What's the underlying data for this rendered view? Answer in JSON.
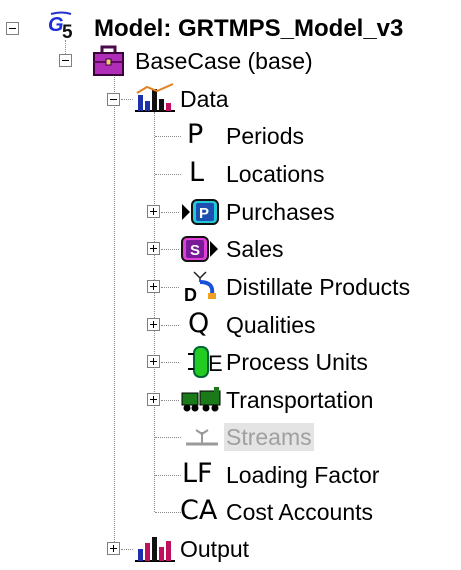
{
  "tree": {
    "root": {
      "label": "Model: GRTMPS_Model_v3",
      "icon": "gs-model-icon"
    },
    "basecase": {
      "label": "BaseCase (base)",
      "icon": "briefcase-icon"
    },
    "data": {
      "label": "Data",
      "icon": "chart-icon",
      "children": [
        {
          "label": "Periods",
          "icon_text": "P"
        },
        {
          "label": "Locations",
          "icon_text": "L"
        },
        {
          "label": "Purchases",
          "icon": "purchases-icon",
          "icon_text": "P"
        },
        {
          "label": "Sales",
          "icon": "sales-icon",
          "icon_text": "S"
        },
        {
          "label": "Distillate Products",
          "icon": "distillate-icon",
          "icon_text": "D"
        },
        {
          "label": "Qualities",
          "icon_text": "Q"
        },
        {
          "label": "Process Units",
          "icon": "process-unit-icon",
          "icon_text": "E"
        },
        {
          "label": "Transportation",
          "icon": "train-icon"
        },
        {
          "label": "Streams",
          "icon": "streams-icon",
          "state": "disabled"
        },
        {
          "label": "Loading Factor",
          "icon_text": "LF"
        },
        {
          "label": "Cost Accounts",
          "icon_text": "CA"
        }
      ]
    },
    "output": {
      "label": "Output",
      "icon": "chart-icon"
    }
  }
}
